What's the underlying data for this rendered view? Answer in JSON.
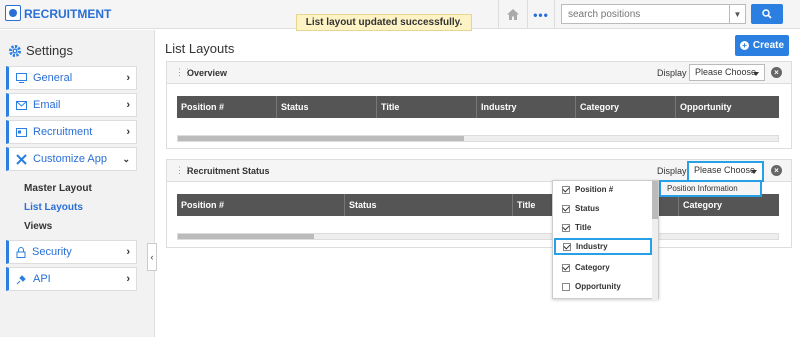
{
  "app": {
    "brand": "RECRUITMENT"
  },
  "flash": "List layout updated successfully.",
  "search": {
    "placeholder": "search positions"
  },
  "sidebar": {
    "title": "Settings",
    "items": [
      {
        "label": "General"
      },
      {
        "label": "Email"
      },
      {
        "label": "Recruitment"
      },
      {
        "label": "Customize App"
      }
    ],
    "subitems": [
      {
        "label": "Master Layout"
      },
      {
        "label": "List Layouts"
      },
      {
        "label": "Views"
      }
    ],
    "bottom_items": [
      {
        "label": "Security"
      },
      {
        "label": "API"
      }
    ]
  },
  "main": {
    "title": "List Layouts",
    "create_label": "Create",
    "panels": [
      {
        "title": "Overview",
        "display_label": "Display",
        "choose_label": "Please Choose",
        "columns": [
          "Position #",
          "Status",
          "Title",
          "Industry",
          "Category",
          "Opportunity"
        ]
      },
      {
        "title": "Recruitment Status",
        "display_label": "Display",
        "choose_label": "Please Choose",
        "columns": [
          "Position #",
          "Status",
          "Title",
          "Category"
        ]
      }
    ]
  },
  "dropdown": {
    "option": "Position Information",
    "items": [
      {
        "label": "Position #",
        "checked": true
      },
      {
        "label": "Status",
        "checked": true
      },
      {
        "label": "Title",
        "checked": true
      },
      {
        "label": "Industry",
        "checked": true
      },
      {
        "label": "Category",
        "checked": true
      },
      {
        "label": "Opportunity",
        "checked": false
      }
    ]
  },
  "colors": {
    "accent": "#2a7fe0",
    "highlight": "#29a0e6",
    "flash_bg": "#fdf3c4"
  }
}
